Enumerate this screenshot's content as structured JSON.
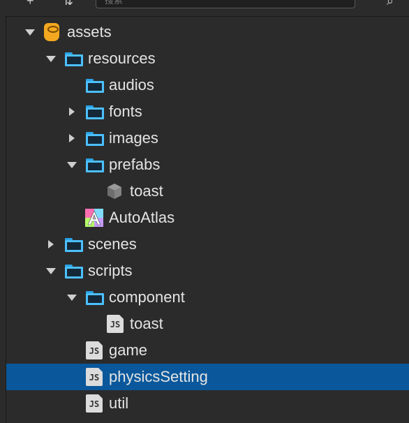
{
  "toolbar": {
    "add_icon": "+",
    "sort_icon": "⇅",
    "search_placeholder": "搜索",
    "search_icon": "⌕"
  },
  "colors": {
    "background": "#2b2b2b",
    "selection": "#0a589b",
    "folder": "#2aa2e6",
    "assets_icon": "#f3a81f"
  },
  "tree": [
    {
      "label": "assets",
      "icon": "database-icon",
      "expand": "down"
    },
    {
      "label": "resources",
      "icon": "folder-icon",
      "expand": "down"
    },
    {
      "label": "audios",
      "icon": "folder-icon",
      "expand": "none"
    },
    {
      "label": "fonts",
      "icon": "folder-icon",
      "expand": "right"
    },
    {
      "label": "images",
      "icon": "folder-icon",
      "expand": "right"
    },
    {
      "label": "prefabs",
      "icon": "folder-icon",
      "expand": "down"
    },
    {
      "label": "toast",
      "icon": "prefab-icon",
      "expand": "none"
    },
    {
      "label": "AutoAtlas",
      "icon": "atlas-icon",
      "expand": "none"
    },
    {
      "label": "scenes",
      "icon": "folder-icon",
      "expand": "right"
    },
    {
      "label": "scripts",
      "icon": "folder-icon",
      "expand": "down"
    },
    {
      "label": "component",
      "icon": "folder-icon",
      "expand": "down"
    },
    {
      "label": "toast",
      "icon": "js-icon",
      "expand": "none"
    },
    {
      "label": "game",
      "icon": "js-icon",
      "expand": "none"
    },
    {
      "label": "physicsSetting",
      "icon": "js-icon",
      "expand": "none",
      "selected": true
    },
    {
      "label": "util",
      "icon": "js-icon",
      "expand": "none"
    }
  ],
  "js_badge": "JS"
}
